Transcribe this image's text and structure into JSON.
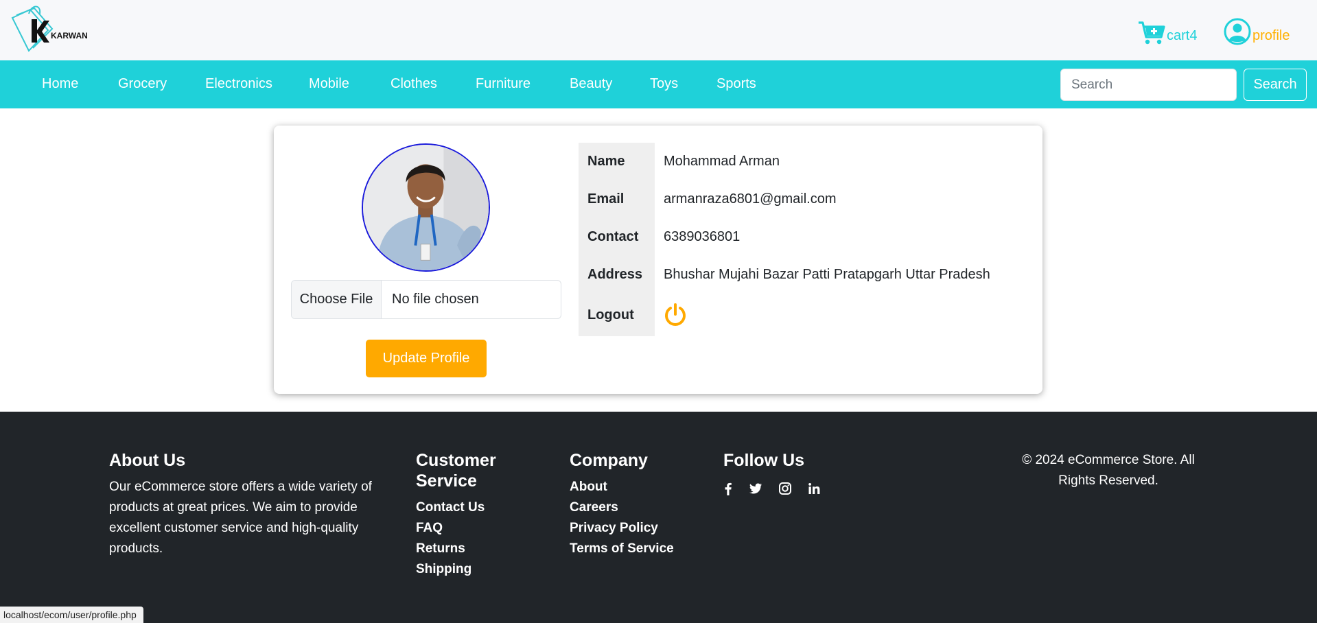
{
  "header": {
    "logo_text": "KARWAN",
    "cart_label": "cart4",
    "profile_label": "profile"
  },
  "nav": {
    "items": [
      "Home",
      "Grocery",
      "Electronics",
      "Mobile",
      "Clothes",
      "Furniture",
      "Beauty",
      "Toys",
      "Sports"
    ],
    "search_placeholder": "Search",
    "search_button": "Search"
  },
  "profile": {
    "file_button": "Choose File",
    "file_status": "No file chosen",
    "update_button": "Update Profile",
    "fields": [
      {
        "label": "Name",
        "value": "Mohammad Arman"
      },
      {
        "label": "Email",
        "value": "armanraza6801@gmail.com"
      },
      {
        "label": "Contact",
        "value": "6389036801"
      },
      {
        "label": "Address",
        "value": "Bhushar Mujahi Bazar Patti Pratapgarh Uttar Pradesh"
      }
    ],
    "logout_label": "Logout"
  },
  "footer": {
    "about_title": "About Us",
    "about_text": "Our eCommerce store offers a wide variety of products at great prices. We aim to provide excellent customer service and high-quality products.",
    "service_title": "Customer Service",
    "service_links": [
      "Contact Us",
      "FAQ",
      "Returns",
      "Shipping"
    ],
    "company_title": "Company",
    "company_links": [
      "About",
      "Careers",
      "Privacy Policy",
      "Terms of Service"
    ],
    "follow_title": "Follow Us",
    "social": [
      "facebook-icon",
      "twitter-icon",
      "instagram-icon",
      "linkedin-icon"
    ],
    "copyright": "© 2024 eCommerce Store. All Rights Reserved."
  },
  "status_bar": {
    "url": "localhost/ecom/user/profile.php"
  },
  "colors": {
    "accent": "#1fd1d9",
    "brand_orange": "#ffa900",
    "footer_bg": "#212529"
  }
}
